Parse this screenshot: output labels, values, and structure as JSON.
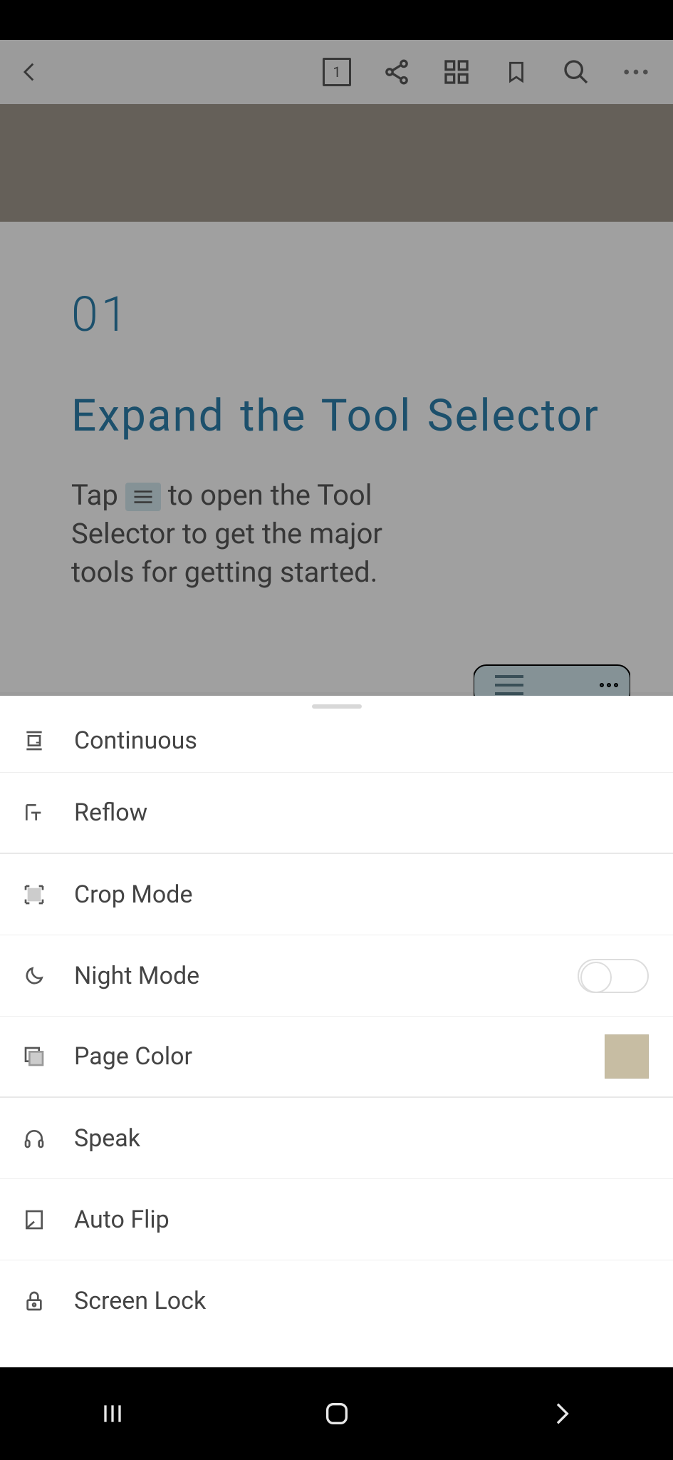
{
  "toolbar": {
    "page_number": "1"
  },
  "document": {
    "chapter_number": "01",
    "heading": "Expand  the Tool Selector",
    "paragraph_before": "Tap ",
    "paragraph_after": " to open the Tool Selector to get the major tools for getting started."
  },
  "menu": {
    "items": [
      {
        "label": "Continuous"
      },
      {
        "label": "Reflow"
      },
      {
        "label": "Crop Mode"
      },
      {
        "label": "Night Mode",
        "toggle": false
      },
      {
        "label": "Page Color",
        "swatch": "#c7bda3"
      },
      {
        "label": "Speak"
      },
      {
        "label": "Auto Flip"
      },
      {
        "label": "Screen Lock"
      }
    ]
  }
}
